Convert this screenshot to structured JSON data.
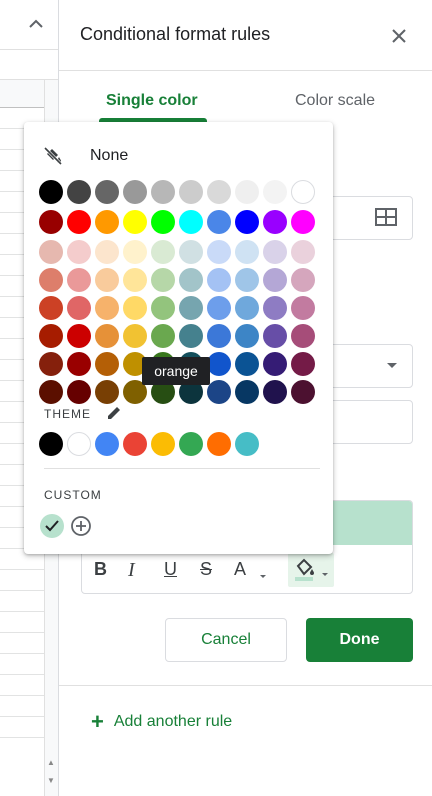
{
  "panel": {
    "title": "Conditional format rules",
    "tabs": {
      "single": "Single color",
      "scale": "Color scale"
    },
    "cancel_label": "Cancel",
    "done_label": "Done",
    "add_rule_label": "Add another rule",
    "add_rule_icon": "+",
    "style_preview_color": "#b7e1cd",
    "format_tools": {
      "bold": "B",
      "italic": "I",
      "underline": "U",
      "strike": "S",
      "text_color": "A"
    }
  },
  "picker": {
    "none_label": "None",
    "tooltip": "orange",
    "theme_label": "THEME",
    "custom_label": "CUSTOM",
    "custom_selected_color": "#b7e1cd",
    "grid": [
      [
        "#000000",
        "#434343",
        "#666666",
        "#999999",
        "#b7b7b7",
        "#cccccc",
        "#d9d9d9",
        "#efefef",
        "#f3f3f3",
        "#ffffff"
      ],
      [
        "#980000",
        "#ff0000",
        "#ff9900",
        "#ffff00",
        "#00ff00",
        "#00ffff",
        "#4a86e8",
        "#0000ff",
        "#9900ff",
        "#ff00ff"
      ],
      [
        "#e6b8af",
        "#f4cccc",
        "#fce5cd",
        "#fff2cc",
        "#d9ead3",
        "#d0e0e3",
        "#c9daf8",
        "#cfe2f3",
        "#d9d2e9",
        "#ead1dc"
      ],
      [
        "#dd7e6b",
        "#ea9999",
        "#f9cb9c",
        "#ffe599",
        "#b6d7a8",
        "#a2c4c9",
        "#a4c2f4",
        "#9fc5e8",
        "#b4a7d6",
        "#d5a6bd"
      ],
      [
        "#cc4125",
        "#e06666",
        "#f6b26b",
        "#ffd966",
        "#93c47d",
        "#76a5af",
        "#6d9eeb",
        "#6fa8dc",
        "#8e7cc3",
        "#c27ba0"
      ],
      [
        "#a61c00",
        "#cc0000",
        "#e69138",
        "#f1c232",
        "#6aa84f",
        "#45818e",
        "#3c78d8",
        "#3d85c6",
        "#674ea7",
        "#a64d79"
      ],
      [
        "#85200c",
        "#990000",
        "#b45f06",
        "#bf9000",
        "#38761d",
        "#134f5c",
        "#1155cc",
        "#0b5394",
        "#351c75",
        "#741b47"
      ],
      [
        "#5b0f00",
        "#660000",
        "#783f04",
        "#7f6000",
        "#274e13",
        "#0c343d",
        "#1c4587",
        "#073763",
        "#20124d",
        "#4c1130"
      ]
    ],
    "theme": [
      "#000000",
      "#ffffff",
      "#4285f4",
      "#ea4335",
      "#fbbc04",
      "#34a853",
      "#ff6d01",
      "#46bdc6"
    ]
  }
}
